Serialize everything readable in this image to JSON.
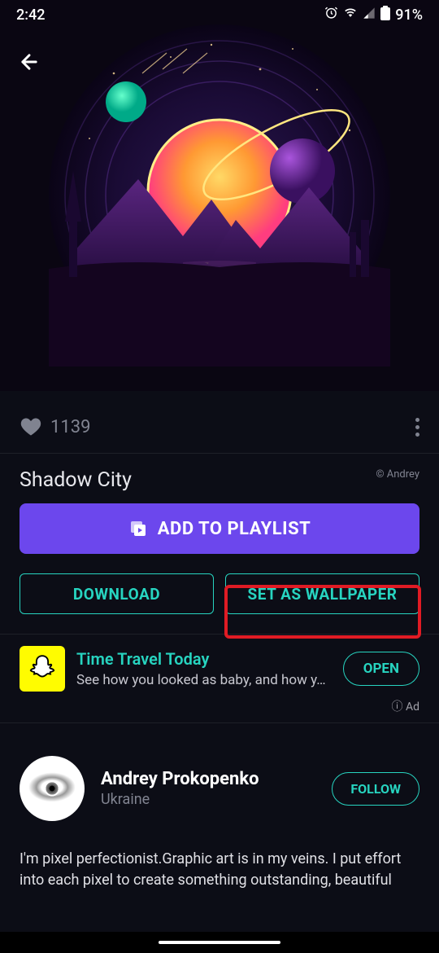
{
  "status": {
    "time": "2:42",
    "battery": "91%"
  },
  "stats": {
    "likes": "1139"
  },
  "wallpaper": {
    "title": "Shadow City",
    "copyright": "© Andrey"
  },
  "buttons": {
    "add_playlist": "ADD TO PLAYLIST",
    "download": "DOWNLOAD",
    "set_wallpaper": "SET AS WALLPAPER"
  },
  "ad": {
    "title": "Time Travel Today",
    "subtitle": "See how you looked as baby, and how y…",
    "cta": "OPEN",
    "label": "Ad"
  },
  "profile": {
    "name": "Andrey Prokopenko",
    "location": "Ukraine",
    "follow": "FOLLOW",
    "bio": "I'm pixel perfectionist.Graphic art is in my veins. I put effort into each pixel to create something outstanding, beautiful"
  }
}
